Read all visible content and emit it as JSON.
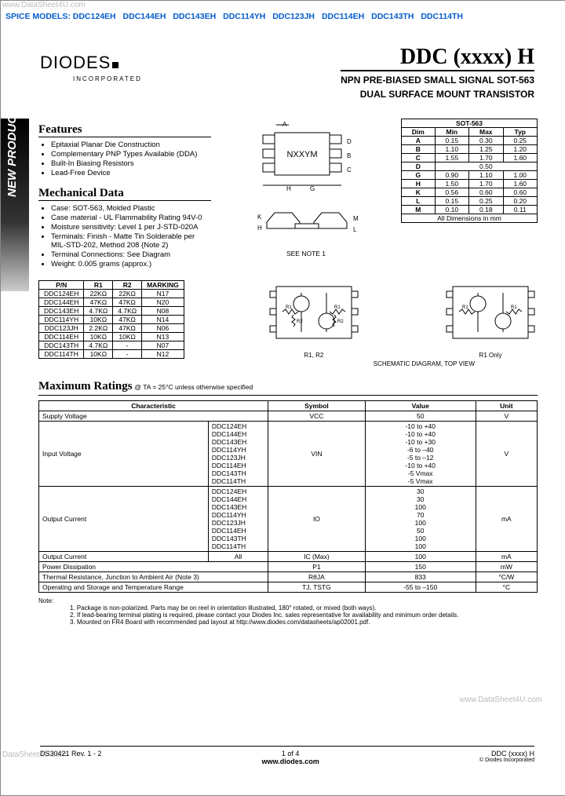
{
  "watermark": "www.DataSheet4U.com",
  "watermark2": "www.DataSheet4U.com",
  "watermark3": "DataSheet4U.com",
  "spice_label": "SPICE MODELS:",
  "spice_models": [
    "DDC124EH",
    "DDC144EH",
    "DDC143EH",
    "DDC114YH",
    "DDC123JH",
    "DDC114EH",
    "DDC143TH",
    "DDC114TH"
  ],
  "logo": "DIODES",
  "logo_sub": "INCORPORATED",
  "title": "DDC (xxxx) H",
  "subtitle1": "NPN PRE-BIASED SMALL SIGNAL SOT-563",
  "subtitle2": "DUAL SURFACE MOUNT TRANSISTOR",
  "sidebar": "NEW PRODUCT",
  "features_h": "Features",
  "features": [
    "Epitaxial Planar Die Construction",
    "Complementary PNP Types Available (DDA)",
    "Built-In Biasing Resistors",
    "Lead-Free Device"
  ],
  "mech_h": "Mechanical Data",
  "mech": [
    "Case: SOT-563, Molded Plastic",
    "Case material - UL Flammability Rating 94V-0",
    "Moisture sensitivity: Level 1 per J-STD-020A",
    "Terminals: Finish - Matte Tin Solderable per MIL-STD-202, Method 208 (Note 2)",
    "Terminal Connections: See Diagram",
    "Weight: 0.005 grams (approx.)"
  ],
  "dims_title": "SOT-563",
  "dims_cols": [
    "Dim",
    "Min",
    "Max",
    "Typ"
  ],
  "dims_rows": [
    [
      "A",
      "0.15",
      "0.30",
      "0.25"
    ],
    [
      "B",
      "1.10",
      "1.25",
      "1.20"
    ],
    [
      "C",
      "1.55",
      "1.70",
      "1.60"
    ],
    [
      "D",
      "",
      "0.50",
      ""
    ],
    [
      "G",
      "0.90",
      "1.10",
      "1.00"
    ],
    [
      "H",
      "1.50",
      "1.70",
      "1.60"
    ],
    [
      "K",
      "0.56",
      "0.60",
      "0.60"
    ],
    [
      "L",
      "0.15",
      "0.25",
      "0.20"
    ],
    [
      "M",
      "0.10",
      "0.18",
      "0.11"
    ]
  ],
  "dims_units": "All Dimensions in mm",
  "see_note": "SEE NOTE 1",
  "pn_cols": [
    "P/N",
    "R1",
    "R2",
    "MARKING"
  ],
  "pn_rows": [
    [
      "DDC124EH",
      "22KΩ",
      "22KΩ",
      "N17"
    ],
    [
      "DDC144EH",
      "47KΩ",
      "47KΩ",
      "N20"
    ],
    [
      "DDC143EH",
      "4.7KΩ",
      "4.7KΩ",
      "N08"
    ],
    [
      "DDC114YH",
      "10KΩ",
      "47KΩ",
      "N14"
    ],
    [
      "DDC123JH",
      "2.2KΩ",
      "47KΩ",
      "N06"
    ],
    [
      "DDC114EH",
      "10KΩ",
      "10KΩ",
      "N13"
    ],
    [
      "DDC143TH",
      "4.7KΩ",
      "-",
      "N07"
    ],
    [
      "DDC114TH",
      "10KΩ",
      "-",
      "N12"
    ]
  ],
  "schem_r12": "R1, R2",
  "schem_r1": "R1 Only",
  "schem_title": "SCHEMATIC DIAGRAM, TOP VIEW",
  "max_h": "Maximum Ratings",
  "max_cond": "@ TA = 25°C unless otherwise specified",
  "ratings_cols": [
    "Characteristic",
    "Symbol",
    "Value",
    "Unit"
  ],
  "r_supply": {
    "c": "Supply Voltage",
    "s": "VCC",
    "v": "50",
    "u": "V"
  },
  "r_input": {
    "c": "Input Voltage",
    "s": "VIN",
    "u": "V",
    "parts": [
      "DDC124EH",
      "DDC144EH",
      "DDC143EH",
      "DDC114YH",
      "DDC123JH",
      "DDC114EH",
      "DDC143TH",
      "DDC114TH"
    ],
    "vals": [
      "-10 to +40",
      "-10 to +40",
      "-10 to +30",
      "-6 to –40",
      "-5 to –12",
      "-10 to +40",
      "-5 Vmax",
      "-5 Vmax"
    ]
  },
  "r_outc": {
    "c": "Output Current",
    "s": "IO",
    "u": "mA",
    "parts": [
      "DDC124EH",
      "DDC144EH",
      "DDC143EH",
      "DDC114YH",
      "DDC123JH",
      "DDC114EH",
      "DDC143TH",
      "DDC114TH"
    ],
    "vals": [
      "30",
      "30",
      "100",
      "70",
      "100",
      "50",
      "100",
      "100"
    ]
  },
  "r_outmax": {
    "c": "Output Current",
    "sub": "All",
    "s": "IC (Max)",
    "v": "100",
    "u": "mA"
  },
  "r_power": {
    "c": "Power Dissipation",
    "s": "P1",
    "v": "150",
    "u": "mW"
  },
  "r_therm": {
    "c": "Thermal Resistance, Junction to Ambient Air (Note 3)",
    "s": "RθJA",
    "v": "833",
    "u": "°C/W"
  },
  "r_temp": {
    "c": "Operating and Storage and Temperature Range",
    "s": "TJ, TSTG",
    "v": "-55 to –150",
    "u": "°C"
  },
  "notes_label": "Note:",
  "notes": [
    "1. Package is non-polarized.  Parts may be on reel in orientation illustrated, 180° rotated, or mixed (both ways).",
    "2. If lead-bearing terminal plating is required, please contact your Diodes Inc. sales representative for availability and minimum order details.",
    "3. Mounted on FR4 Board with recommended pad layout at http://www.diodes.com/datasheets/ap02001.pdf."
  ],
  "footer_left": "DS30421 Rev. 1 - 2",
  "footer_center_1": "1 of 4",
  "footer_center_2": "www.diodes.com",
  "footer_right_1": "DDC (xxxx) H",
  "footer_right_2": "© Diodes Incorporated",
  "pkg_label": "NXXYM"
}
